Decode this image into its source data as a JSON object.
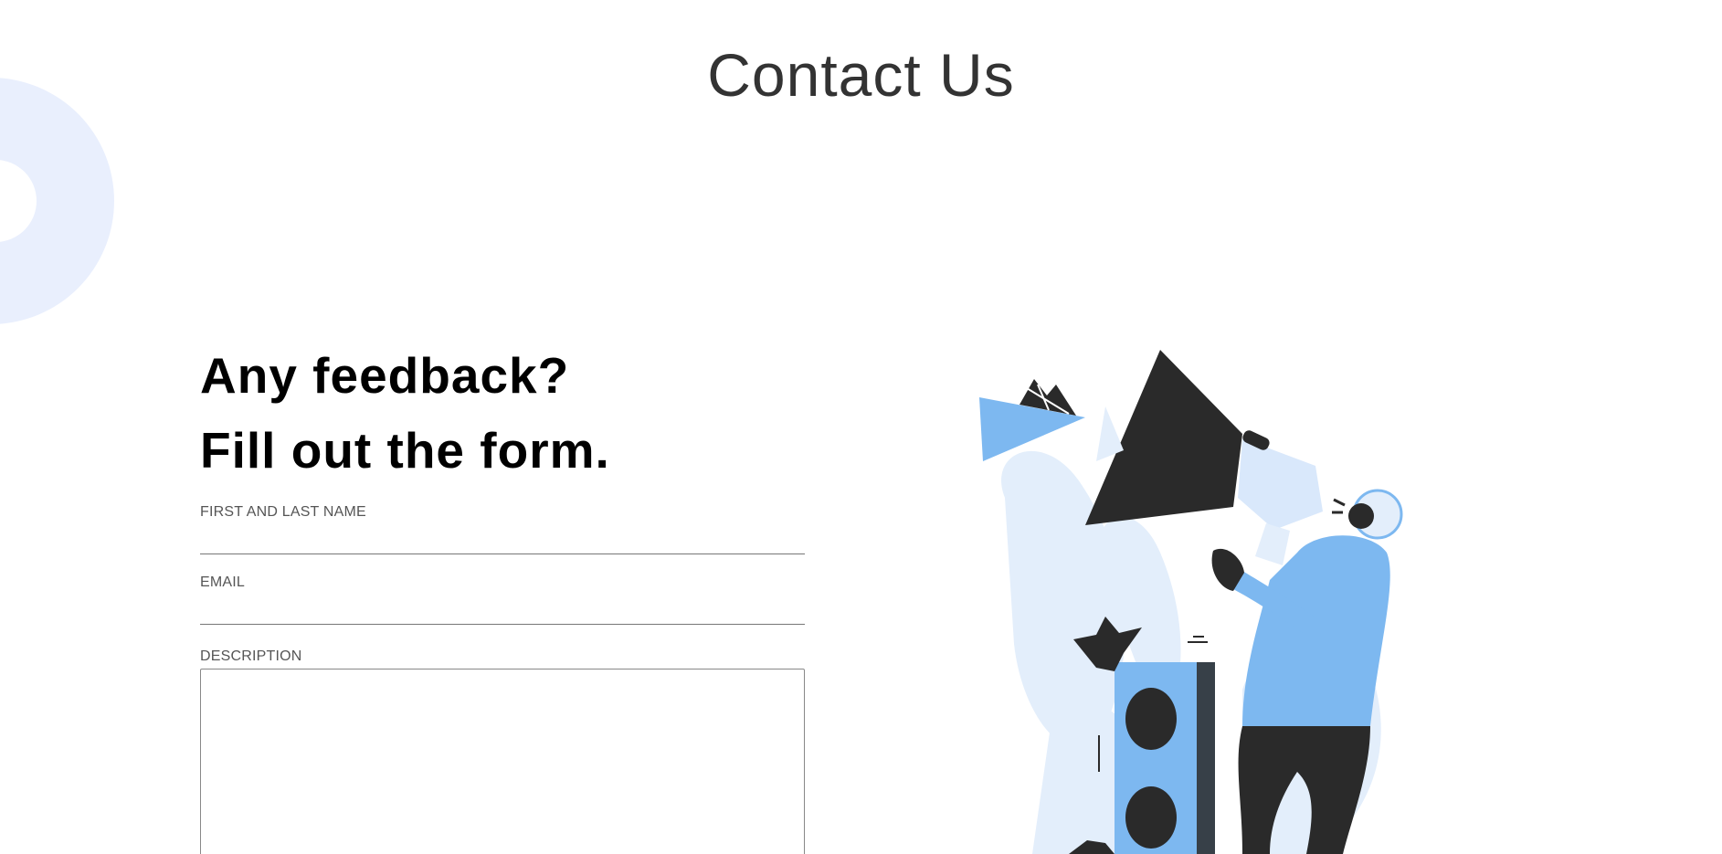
{
  "page": {
    "title": "Contact Us"
  },
  "form": {
    "headline_line1": "Any feedback?",
    "headline_line2": "Fill out the form.",
    "name_label": "FIRST AND LAST NAME",
    "name_value": "",
    "email_label": "EMAIL",
    "email_value": "",
    "description_label": "DESCRIPTION",
    "description_value": ""
  },
  "illustration": {
    "icon": "megaphone-person-illustration"
  },
  "colors": {
    "title": "#333333",
    "headline": "#000000",
    "accent_blue": "#7db8f0",
    "pale_blue": "#e3eefb",
    "ring": "#e9effd",
    "ink": "#2a2a2a"
  }
}
